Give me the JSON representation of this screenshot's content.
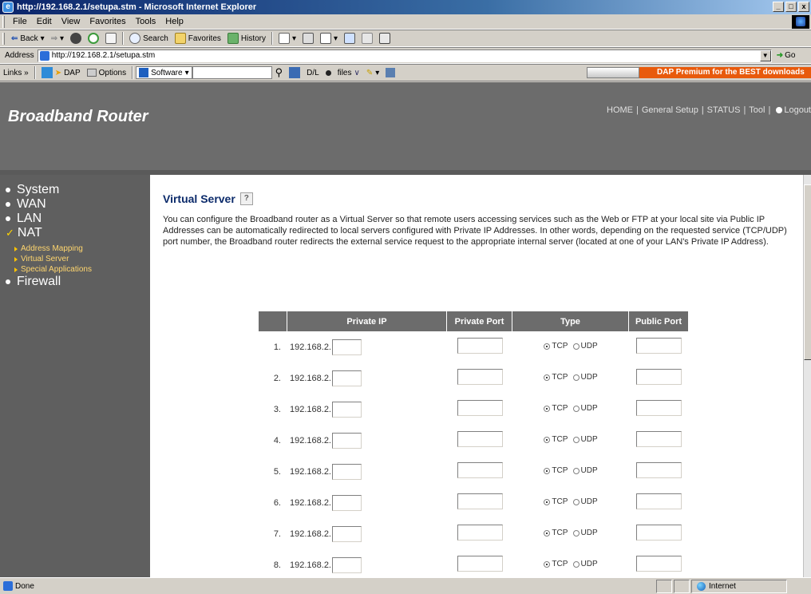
{
  "window": {
    "title": "http://192.168.2.1/setupa.stm - Microsoft Internet Explorer",
    "buttons": [
      "_",
      "□",
      "x"
    ]
  },
  "menu": [
    "File",
    "Edit",
    "View",
    "Favorites",
    "Tools",
    "Help"
  ],
  "toolbar": {
    "back": "Back",
    "search": "Search",
    "favorites": "Favorites",
    "history": "History"
  },
  "address": {
    "label": "Address",
    "url": "http://192.168.2.1/setupa.stm",
    "go": "Go"
  },
  "links_bar": {
    "links": "Links »",
    "dap": "DAP",
    "options": "Options",
    "software": "Software",
    "dl": "D/L",
    "files": "files",
    "promo": "DAP Premium for the BEST downloads"
  },
  "header": {
    "brand": "Broadband Router",
    "nav": [
      "HOME",
      "General Setup",
      "STATUS",
      "Tool",
      "Logout"
    ]
  },
  "sidebar": {
    "items": [
      {
        "label": "System",
        "marker": "bullet"
      },
      {
        "label": "WAN",
        "marker": "bullet"
      },
      {
        "label": "LAN",
        "marker": "bullet"
      },
      {
        "label": "NAT",
        "marker": "check"
      }
    ],
    "sub_items": [
      "Address Mapping",
      "Virtual Server",
      "Special Applications"
    ],
    "after": {
      "label": "Firewall",
      "marker": "bullet"
    }
  },
  "main": {
    "title": "Virtual Server",
    "help_icon": "?",
    "description": "You can configure the Broadband router as a Virtual Server so that remote users accessing services such as the Web or FTP at your local site via Public IP Addresses can be automatically redirected to local servers configured with Private IP Addresses. In other words, depending on the requested service (TCP/UDP) port number, the Broadband router redirects the external service request to the appropriate internal server (located at one of your LAN's Private IP Address).",
    "table": {
      "headers": [
        "",
        "Private IP",
        "Private Port",
        "Type",
        "Public Port"
      ],
      "ip_prefix": "192.168.2.",
      "tcp_label": "TCP",
      "udp_label": "UDP",
      "rows": [
        {
          "num": "1.",
          "type": "TCP"
        },
        {
          "num": "2.",
          "type": "TCP"
        },
        {
          "num": "3.",
          "type": "TCP"
        },
        {
          "num": "4.",
          "type": "TCP"
        },
        {
          "num": "5.",
          "type": "TCP"
        },
        {
          "num": "6.",
          "type": "TCP"
        },
        {
          "num": "7.",
          "type": "TCP"
        },
        {
          "num": "8.",
          "type": "TCP"
        }
      ]
    }
  },
  "status": {
    "text": "Done",
    "zone": "Internet"
  }
}
